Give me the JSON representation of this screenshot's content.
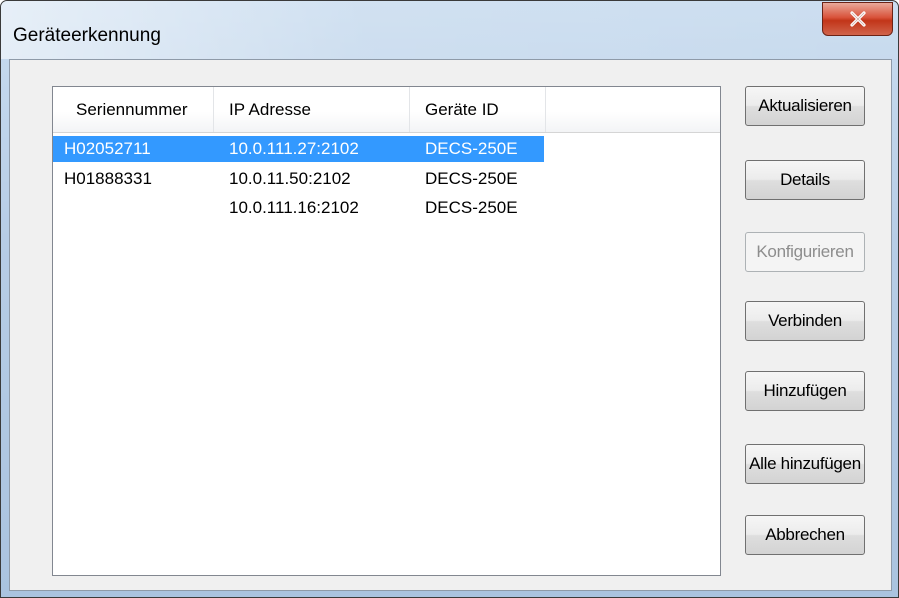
{
  "window": {
    "title": "Geräteerkennung"
  },
  "listview": {
    "columns": [
      "Seriennummer",
      "IP Adresse",
      "Geräte ID"
    ],
    "rows": [
      {
        "serial": "H02052711",
        "ip": "10.0.111.27:2102",
        "device_id": "DECS-250E",
        "selected": true
      },
      {
        "serial": "H01888331",
        "ip": "10.0.11.50:2102",
        "device_id": "DECS-250E",
        "selected": false
      },
      {
        "serial": "",
        "ip": "10.0.111.16:2102",
        "device_id": "DECS-250E",
        "selected": false
      }
    ]
  },
  "buttons": {
    "refresh": "Aktualisieren",
    "details": "Details",
    "configure": "Konfigurieren",
    "connect": "Verbinden",
    "add": "Hinzufügen",
    "add_all": "Alle hinzufügen",
    "cancel": "Abbrechen"
  },
  "colors": {
    "selection": "#3399ff",
    "close_button": "#c84128"
  }
}
